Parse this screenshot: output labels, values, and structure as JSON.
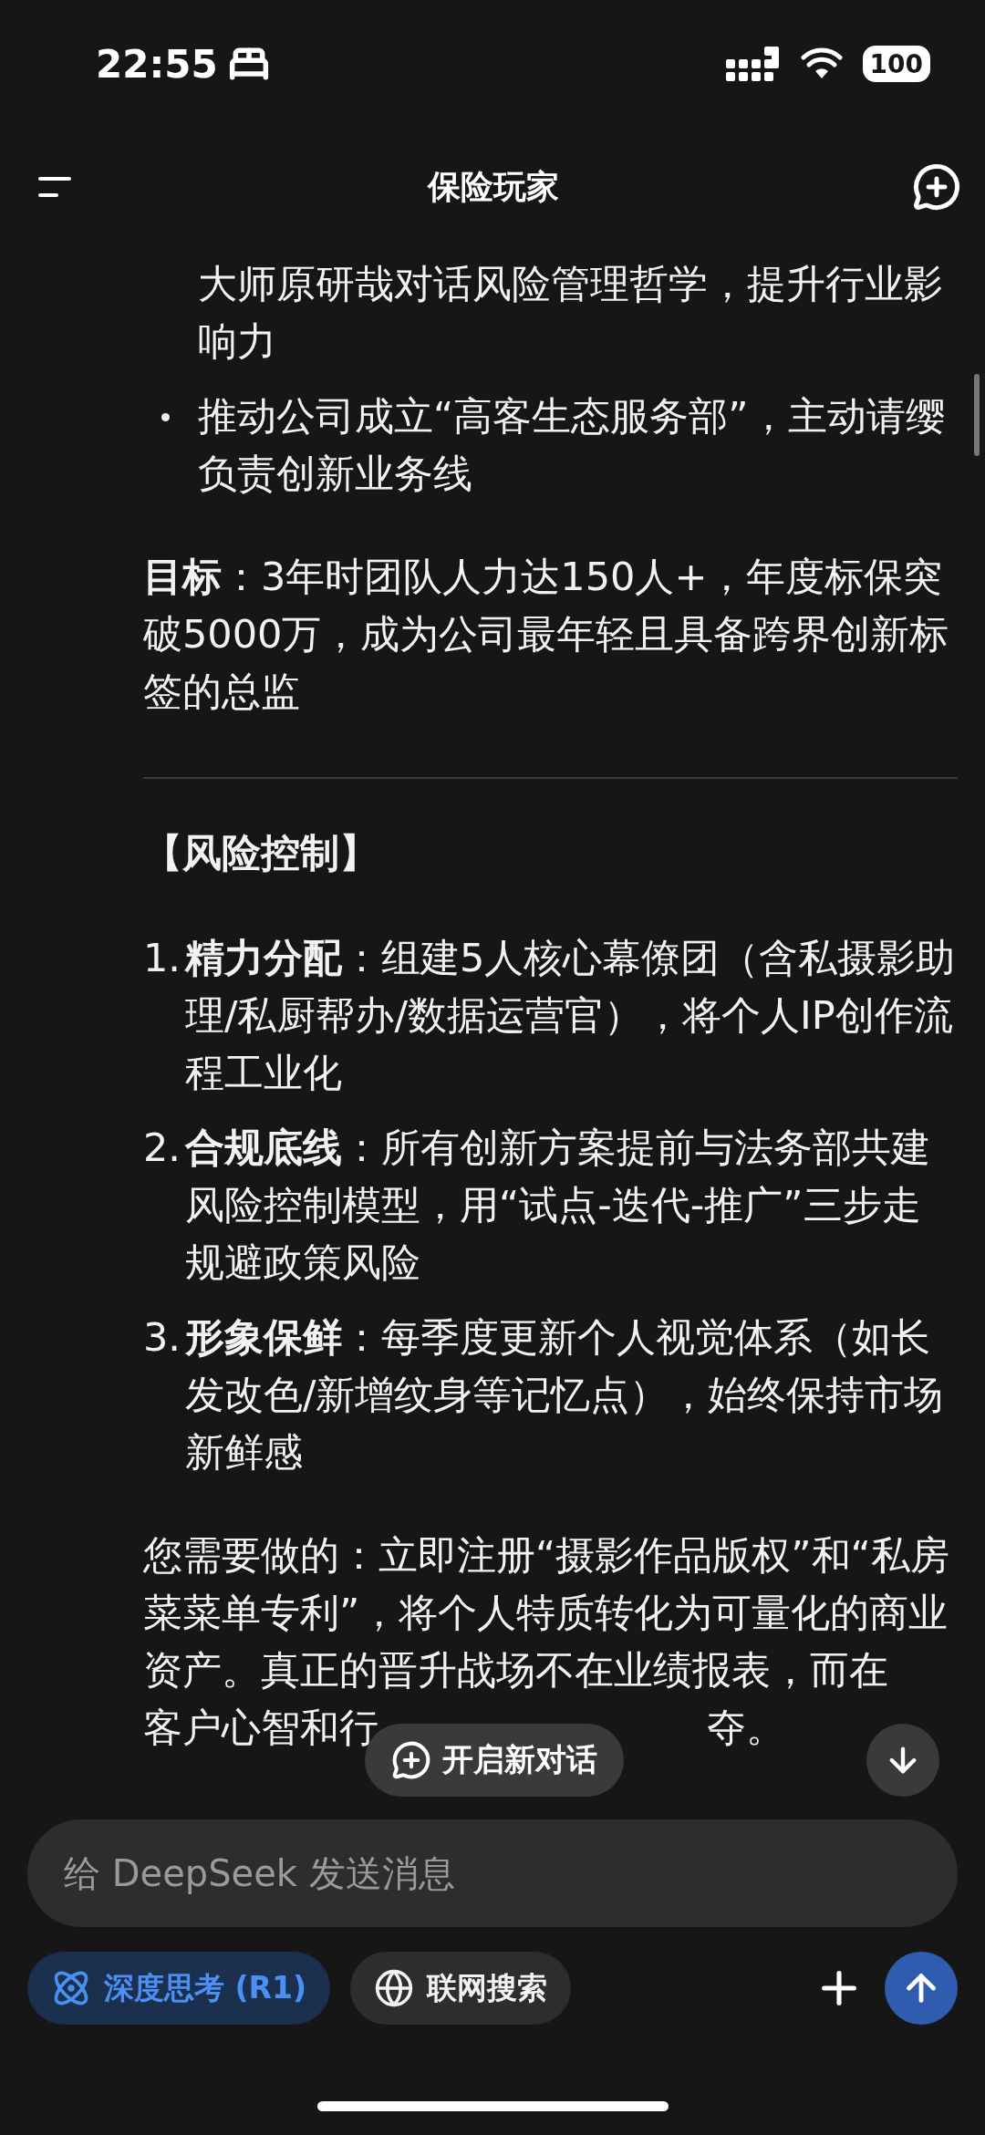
{
  "status_bar": {
    "time": "22:55",
    "battery": "100"
  },
  "header": {
    "title": "保险玩家"
  },
  "content": [
    {
      "kind": "continuation",
      "text": "大师原研哉对话风险管理哲学，提升行业影响力"
    },
    {
      "kind": "bullet",
      "text": "推动公司成立“高客生态服务部”，主动请缨负责创新业务线"
    },
    {
      "kind": "paragraph",
      "text": "**目标**：3年时团队人力达150人+，年度标保突破5000万，成为公司最年轻且具备跨界创新标签的总监"
    },
    {
      "kind": "divider"
    },
    {
      "kind": "heading",
      "text": "【风险控制】"
    },
    {
      "kind": "numbered",
      "number": "1.",
      "text": "**精力分配**：组建5人核心幕僚团（含私摄影助理/私厨帮办/数据运营官），将个人IP创作流程工业化"
    },
    {
      "kind": "numbered",
      "number": "2.",
      "text": "**合规底线**：所有创新方案提前与法务部共建风险控制模型，用“试点-迭代-推广”三步走规避政策风险"
    },
    {
      "kind": "numbered",
      "number": "3.",
      "text": "**形象保鲜**：每季度更新个人视觉体系（如长发改色/新增纹身等记忆点），始终保持市场新鲜感"
    },
    {
      "kind": "paragraph",
      "text": "您需要做的：立即注册“摄影作品版权”和“私房菜菜单专利”，将个人特质转化为可量化的商业资产。真正的晋升战场不在业绩报表，而在"
    },
    {
      "kind": "covered_line",
      "before": "客户心智和行",
      "after": "夺。"
    }
  ],
  "new_chat_button": {
    "label": "开启新对话"
  },
  "composer": {
    "placeholder": "给 DeepSeek 发送消息"
  },
  "toggles": [
    {
      "kind": "think",
      "label": "深度思考 (R1)",
      "selected": true
    },
    {
      "kind": "search",
      "label": "联网搜索",
      "selected": false
    }
  ]
}
